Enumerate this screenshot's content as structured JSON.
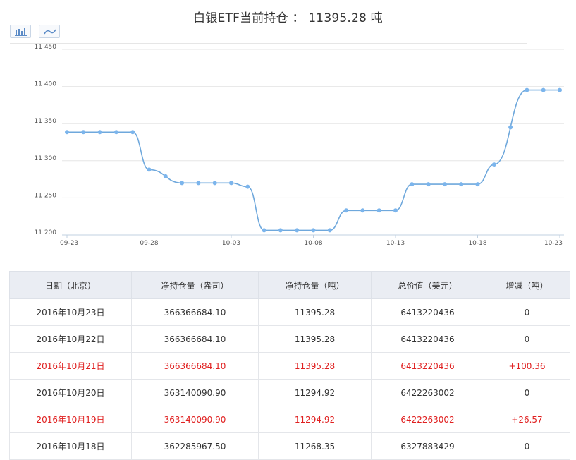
{
  "title": "白银ETF当前持仓 ： 11395.28 吨",
  "toolbar": {
    "bar_icon": "bar-chart-icon",
    "line_icon": "line-chart-icon"
  },
  "colors": {
    "line": "#6fa8dc",
    "point": "#7cb5ec",
    "grid": "#e6e6e6",
    "up": "#e02020",
    "header_bg": "#eaedf3"
  },
  "chart_data": {
    "type": "line",
    "x": [
      "09-23",
      "09-24",
      "09-25",
      "09-26",
      "09-27",
      "09-28",
      "09-29",
      "09-30",
      "10-01",
      "10-02",
      "10-03",
      "10-04",
      "10-05",
      "10-06",
      "10-07",
      "10-08",
      "10-09",
      "10-10",
      "10-11",
      "10-12",
      "10-13",
      "10-14",
      "10-15",
      "10-16",
      "10-17",
      "10-18",
      "10-19",
      "10-20",
      "10-21",
      "10-22",
      "10-23"
    ],
    "series": [
      {
        "values": [
          11338.5,
          null,
          11338.5,
          null,
          11338.5,
          11288,
          null,
          11270,
          null,
          11270,
          11270,
          11265,
          11206.3,
          null,
          11206.3,
          null,
          11206.3,
          11233,
          null,
          11233,
          11233,
          11268.35,
          null,
          11268.35,
          null,
          11268.35,
          11294.92,
          null,
          11395.28,
          null,
          11395.28
        ]
      }
    ],
    "xticks": [
      "09-23",
      "09-28",
      "10-03",
      "10-08",
      "10-13",
      "10-18",
      "10-23"
    ],
    "yticks": [
      "11 200",
      "11 250",
      "11 300",
      "11 350",
      "11 400",
      "11 450"
    ],
    "ylim": [
      11200,
      11450
    ],
    "grid": true,
    "legend": "none"
  },
  "table": {
    "headers": [
      "日期（北京）",
      "净持仓量（盎司）",
      "净持仓量（吨）",
      "总价值（美元）",
      "增减（吨）"
    ],
    "rows": [
      {
        "cells": [
          "2016年10月23日",
          "366366684.10",
          "11395.28",
          "6413220436",
          "0"
        ],
        "highlight": false
      },
      {
        "cells": [
          "2016年10月22日",
          "366366684.10",
          "11395.28",
          "6413220436",
          "0"
        ],
        "highlight": false
      },
      {
        "cells": [
          "2016年10月21日",
          "366366684.10",
          "11395.28",
          "6413220436",
          "+100.36"
        ],
        "highlight": true
      },
      {
        "cells": [
          "2016年10月20日",
          "363140090.90",
          "11294.92",
          "6422263002",
          "0"
        ],
        "highlight": false
      },
      {
        "cells": [
          "2016年10月19日",
          "363140090.90",
          "11294.92",
          "6422263002",
          "+26.57"
        ],
        "highlight": true
      },
      {
        "cells": [
          "2016年10月18日",
          "362285967.50",
          "11268.35",
          "6327883429",
          "0"
        ],
        "highlight": false
      }
    ]
  }
}
